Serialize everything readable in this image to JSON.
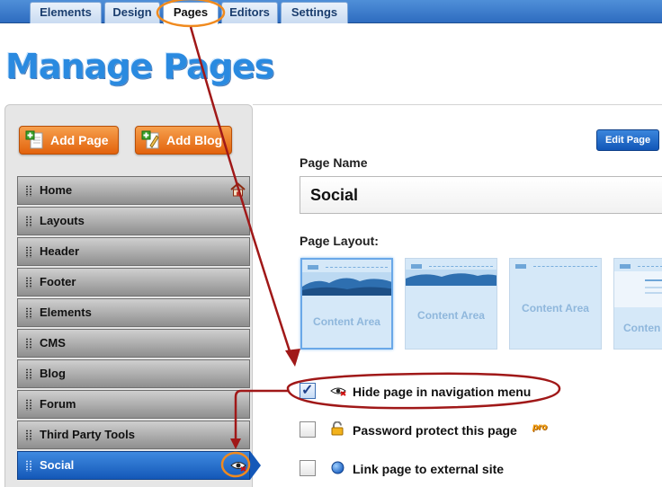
{
  "tabs": [
    {
      "label": "Elements"
    },
    {
      "label": "Design"
    },
    {
      "label": "Pages"
    },
    {
      "label": "Editors"
    },
    {
      "label": "Settings"
    }
  ],
  "page_title": "Manage Pages",
  "buttons": {
    "add_page": "Add Page",
    "add_blog": "Add Blog",
    "edit_page": "Edit Page"
  },
  "nav_items": [
    {
      "label": "Home",
      "icon": "home-icon"
    },
    {
      "label": "Layouts"
    },
    {
      "label": "Header"
    },
    {
      "label": "Footer"
    },
    {
      "label": "Elements"
    },
    {
      "label": "CMS"
    },
    {
      "label": "Blog"
    },
    {
      "label": "Forum"
    },
    {
      "label": "Third Party Tools"
    },
    {
      "label": "Social",
      "icon": "hidden-eye-icon",
      "selected": true
    }
  ],
  "form": {
    "page_name_label": "Page Name",
    "page_name_value": "Social",
    "page_layout_label": "Page Layout:",
    "layouts": [
      {
        "label": "Content Area",
        "selected": true
      },
      {
        "label": "Content Area"
      },
      {
        "label": "Content Area"
      },
      {
        "label": "Conten"
      }
    ]
  },
  "options": [
    {
      "label": "Hide page in navigation menu",
      "checked": true,
      "icon": "hidden-eye-icon"
    },
    {
      "label": "Password protect this page",
      "checked": false,
      "icon": "lock-icon",
      "badge": "pro"
    },
    {
      "label": "Link page to external site",
      "checked": false,
      "icon": "globe-icon"
    }
  ],
  "colors": {
    "accent_blue": "#1458b8",
    "annotation_red": "#a01818",
    "annotation_orange": "#f08a1e",
    "button_orange": "#e2620c"
  }
}
